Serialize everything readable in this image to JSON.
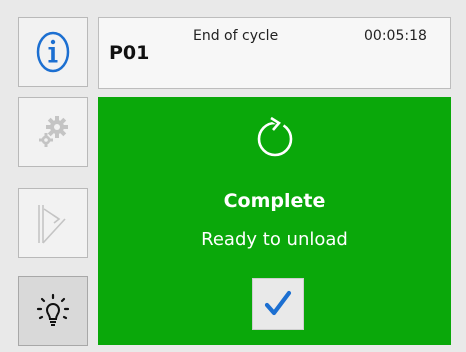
{
  "sidebar": {
    "buttons": [
      {
        "name": "info",
        "icon": "info-icon"
      },
      {
        "name": "settings",
        "icon": "gears-icon"
      },
      {
        "name": "valve",
        "icon": "valve-icon"
      },
      {
        "name": "light",
        "icon": "lightbulb-icon"
      }
    ]
  },
  "header": {
    "program": "P01",
    "status": "End of cycle",
    "timer": "00:05:18"
  },
  "panel": {
    "icon": "cycle-complete-icon",
    "title": "Complete",
    "subtitle": "Ready to unload",
    "confirm_icon": "checkmark-icon",
    "color": "#0aa80a"
  },
  "colors": {
    "info_icon": "#1c6fd1",
    "checkmark": "#1c6fd1",
    "disabled_icon": "#c4c4c4"
  }
}
